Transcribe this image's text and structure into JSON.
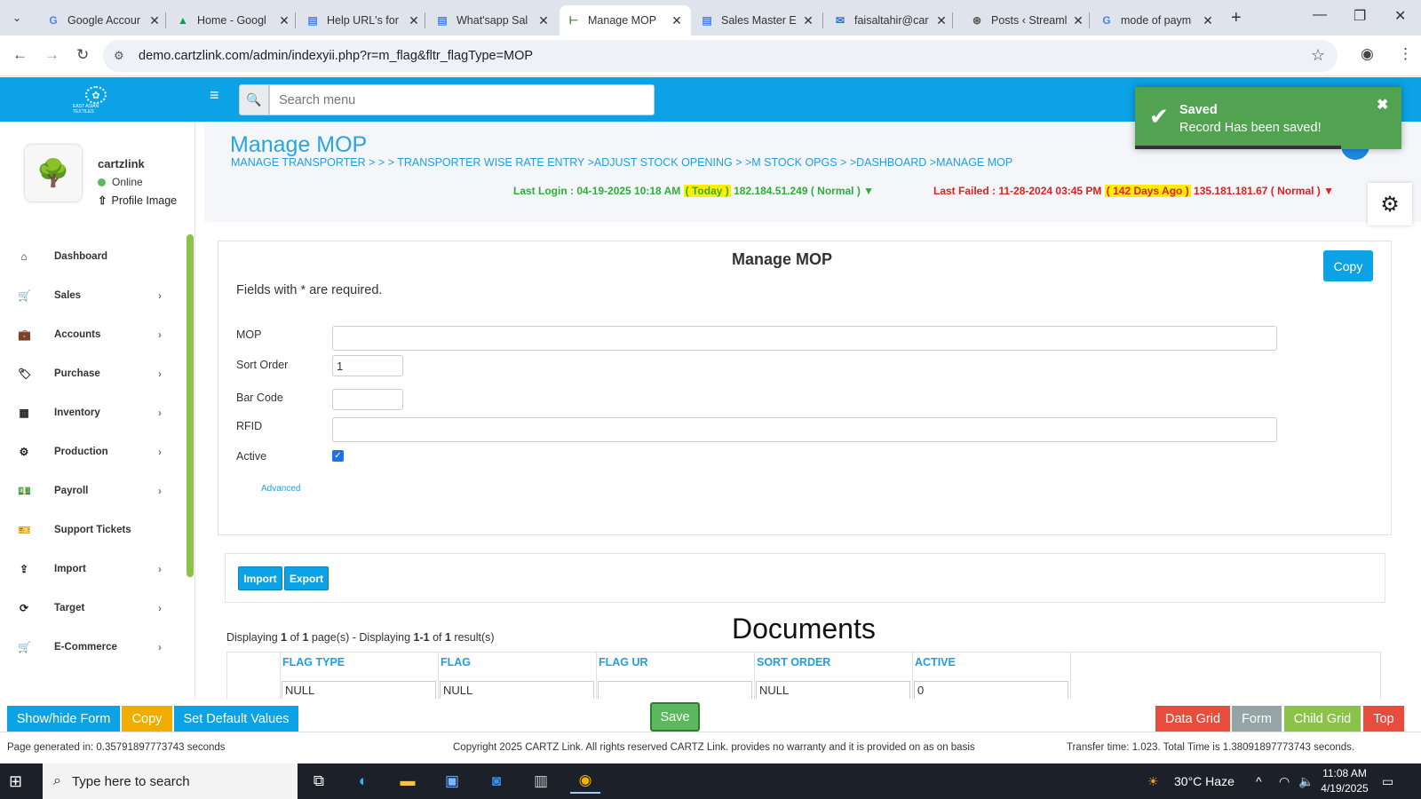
{
  "browser": {
    "tabs": [
      {
        "title": "Google Accour",
        "icon": "google-icon"
      },
      {
        "title": "Home - Googl",
        "icon": "drive-icon"
      },
      {
        "title": "Help URL's for",
        "icon": "docs-icon"
      },
      {
        "title": "What'sapp Sal",
        "icon": "docs-icon"
      },
      {
        "title": "Manage MOP",
        "icon": "cartz-icon",
        "active": true
      },
      {
        "title": "Sales Master E",
        "icon": "docs-icon"
      },
      {
        "title": "faisaltahir@car",
        "icon": "mail-icon"
      },
      {
        "title": "Posts ‹ Streaml",
        "icon": "wordpress-icon"
      },
      {
        "title": "mode of paym",
        "icon": "google-icon"
      }
    ],
    "url": "demo.cartzlink.com/admin/indexyii.php?r=m_flag&fltr_flagType=MOP"
  },
  "header": {
    "search_placeholder": "Search menu",
    "logo_text": "EAST ASIAN TEXTILES"
  },
  "user": {
    "name": "cartzlink",
    "status": "Online",
    "profile_link": "Profile Image"
  },
  "sidebar": {
    "items": [
      {
        "label": "Dashboard",
        "icon": "home-icon",
        "glyph": "⌂",
        "has_children": false
      },
      {
        "label": "Sales",
        "icon": "cart-icon",
        "glyph": "🛒",
        "has_children": true
      },
      {
        "label": "Accounts",
        "icon": "briefcase-icon",
        "glyph": "💼",
        "has_children": true
      },
      {
        "label": "Purchase",
        "icon": "tags-icon",
        "glyph": "🏷",
        "has_children": true
      },
      {
        "label": "Inventory",
        "icon": "grid-icon",
        "glyph": "▦",
        "has_children": true
      },
      {
        "label": "Production",
        "icon": "gears-icon",
        "glyph": "⚙",
        "has_children": true
      },
      {
        "label": "Payroll",
        "icon": "money-icon",
        "glyph": "💵",
        "has_children": true
      },
      {
        "label": "Support Tickets",
        "icon": "ticket-icon",
        "glyph": "🎫",
        "has_children": false
      },
      {
        "label": "Import",
        "icon": "upload-icon",
        "glyph": "⇪",
        "has_children": true
      },
      {
        "label": "Target",
        "icon": "refresh-icon",
        "glyph": "⟳",
        "has_children": true
      },
      {
        "label": "E-Commerce",
        "icon": "cart-icon",
        "glyph": "🛒",
        "has_children": true
      }
    ]
  },
  "page": {
    "title": "Manage MOP",
    "breadcrumb": "MANAGE TRANSPORTER  >  >  > TRANSPORTER WISE RATE ENTRY  >ADJUST STOCK OPENING  >  >M STOCK OPGS  >  >DASHBOARD  >MANAGE MOP",
    "last_login": {
      "prefix": "Last Login : 04-19-2025 10:18 AM",
      "highlight": "( Today )",
      "suffix": "182.184.51.249 ( Normal ) ▼"
    },
    "last_failed": {
      "prefix": "Last Failed : 11-28-2024 03:45 PM",
      "highlight": "( 142 Days Ago )",
      "suffix": "135.181.181.67 ( Normal ) ▼"
    }
  },
  "toast": {
    "title": "Saved",
    "message": "Record Has been saved!"
  },
  "form": {
    "title": "Manage MOP",
    "copy_label": "Copy",
    "required_note": "Fields with * are required.",
    "fields": {
      "mop": {
        "label": "MOP",
        "value": ""
      },
      "sort_order": {
        "label": "Sort Order",
        "value": "1"
      },
      "bar_code": {
        "label": "Bar Code",
        "value": ""
      },
      "rfid": {
        "label": "RFID",
        "value": ""
      },
      "active": {
        "label": "Active",
        "checked": true
      }
    },
    "advanced_link": "Advanced"
  },
  "import_export": {
    "import_label": "Import",
    "export_label": "Export"
  },
  "grid": {
    "display_info_parts": [
      "Displaying ",
      "1",
      " of ",
      "1",
      " page(s)  -  Displaying ",
      "1-1",
      " of ",
      "1",
      " result(s)"
    ],
    "title": "Documents",
    "columns": [
      "FLAG TYPE",
      "FLAG",
      "FLAG UR",
      "SORT ORDER",
      "ACTIVE"
    ],
    "filter_values": [
      "NULL",
      "NULL",
      "",
      "NULL",
      "0"
    ]
  },
  "actions": {
    "show_hide_form": "Show/hide Form",
    "copy": "Copy",
    "set_default_values": "Set Default Values",
    "save": "Save",
    "data_grid": "Data Grid",
    "form": "Form",
    "child_grid": "Child Grid",
    "top": "Top"
  },
  "footer": {
    "page_generated": "Page generated in: 0.35791897773743 seconds",
    "copyright": "Copyright 2025 CARTZ Link. All rights reserved CARTZ Link. provides no warranty and it is provided on as on basis",
    "transfer_time": "Transfer time: 1.023. Total Time is 1.38091897773743 seconds."
  },
  "taskbar": {
    "search_placeholder": "Type here to search",
    "weather": "30°C  Haze",
    "time": "11:08 AM",
    "date": "4/19/2025"
  },
  "colors": {
    "brand_blue": "#0ba3e6",
    "success_green": "#51a351",
    "copy_yellow": "#f0ad00",
    "danger_red": "#e74c3c",
    "grey": "#95a5a6",
    "light_green": "#8bc34a"
  }
}
